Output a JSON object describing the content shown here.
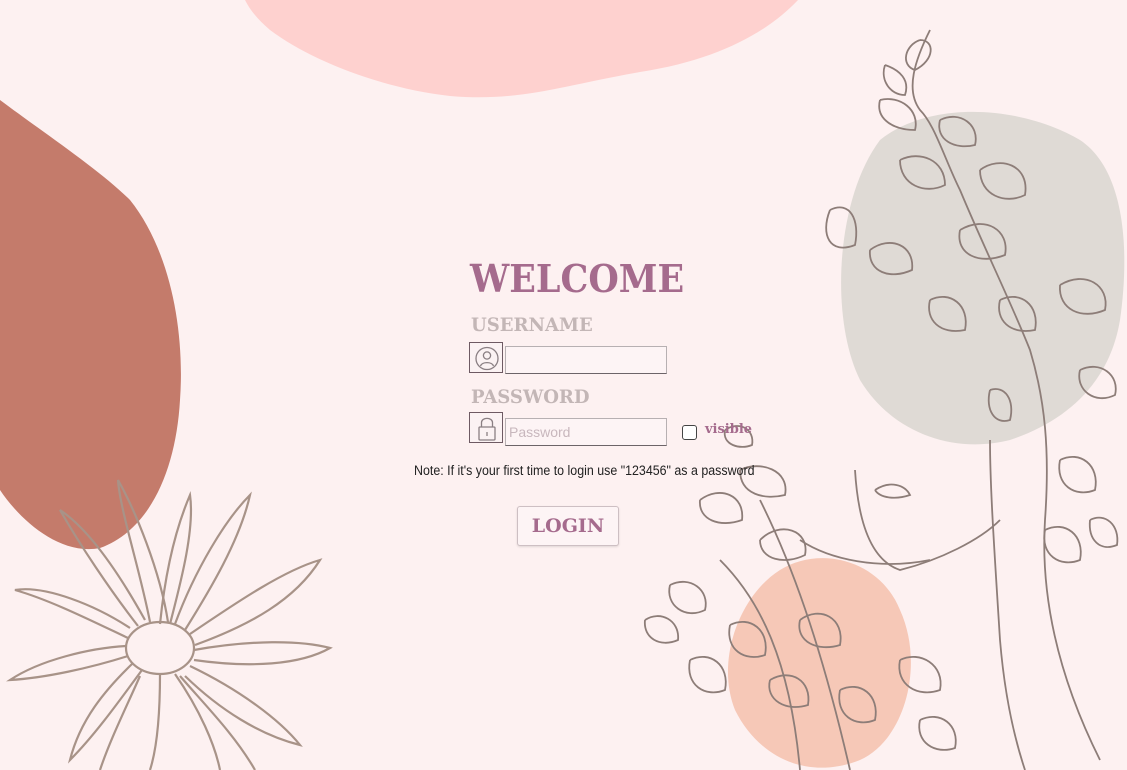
{
  "login": {
    "title": "WELCOME",
    "username_label": "USERNAME",
    "username_value": "",
    "password_label": "PASSWORD",
    "password_placeholder": "Password",
    "visible_label": "visible",
    "visible_checked": false,
    "note": "Note: If it's your first time to login use \"123456\" as a password",
    "login_button": "LOGIN"
  },
  "icons": {
    "username": "user-icon",
    "password": "lock-icon"
  },
  "colors": {
    "background": "#fdf1f1",
    "accent": "#a56b8d",
    "label": "#c3b6b6",
    "blob_top": "#fed1cf",
    "blob_left": "#c47b6b",
    "blob_grey": "#dcd7d1",
    "blob_peach": "#f3b9a3",
    "line_art": "#8d7d78"
  }
}
